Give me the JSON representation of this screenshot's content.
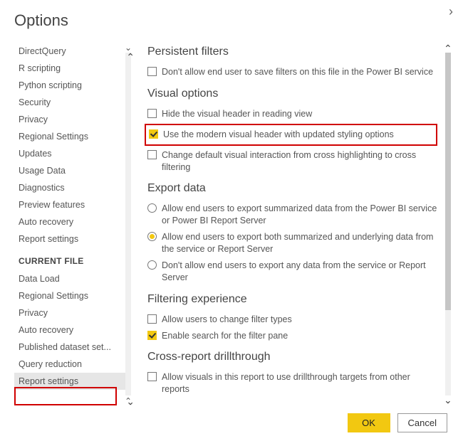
{
  "title": "Options",
  "sidebar": {
    "global_items": [
      "DirectQuery",
      "R scripting",
      "Python scripting",
      "Security",
      "Privacy",
      "Regional Settings",
      "Updates",
      "Usage Data",
      "Diagnostics",
      "Preview features",
      "Auto recovery",
      "Report settings"
    ],
    "section_header": "CURRENT FILE",
    "file_items": [
      "Data Load",
      "Regional Settings",
      "Privacy",
      "Auto recovery",
      "Published dataset set...",
      "Query reduction",
      "Report settings"
    ],
    "selected": "Report settings"
  },
  "sections": {
    "persistent": {
      "title": "Persistent filters",
      "opt0": "Don't allow end user to save filters on this file in the Power BI service"
    },
    "visual": {
      "title": "Visual options",
      "opt0": "Hide the visual header in reading view",
      "opt1": "Use the modern visual header with updated styling options",
      "opt2": "Change default visual interaction from cross highlighting to cross filtering"
    },
    "export": {
      "title": "Export data",
      "opt0": "Allow end users to export summarized data from the Power BI service or Power BI Report Server",
      "opt1": "Allow end users to export both summarized and underlying data from the service or Report Server",
      "opt2": "Don't allow end users to export any data from the service or Report Server"
    },
    "filtering": {
      "title": "Filtering experience",
      "opt0": "Allow users to change filter types",
      "opt1": "Enable search for the filter pane"
    },
    "cross": {
      "title": "Cross-report drillthrough",
      "opt0": "Allow visuals in this report to use drillthrough targets from other reports"
    }
  },
  "buttons": {
    "ok": "OK",
    "cancel": "Cancel"
  }
}
